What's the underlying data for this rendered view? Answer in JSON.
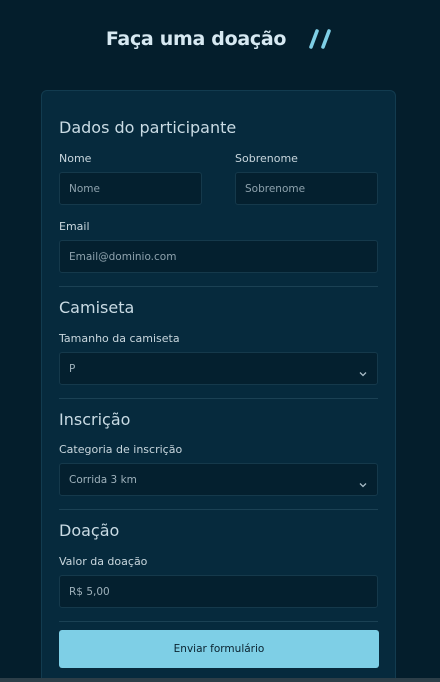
{
  "header": {
    "title": "Faça uma doação",
    "logo_icon": "double-slash-logo-icon",
    "accent_color": "#7ecfe6"
  },
  "form": {
    "participant": {
      "section_title": "Dados do participante",
      "first_name_label": "Nome",
      "first_name_placeholder": "Nome",
      "last_name_label": "Sobrenome",
      "last_name_placeholder": "Sobrenome",
      "email_label": "Email",
      "email_placeholder": "Email@dominio.com"
    },
    "shirt": {
      "section_title": "Camiseta",
      "size_label": "Tamanho da camiseta",
      "size_value": "P"
    },
    "registration": {
      "section_title": "Inscrição",
      "category_label": "Categoria de inscrição",
      "category_value": "Corrida 3 km"
    },
    "donation": {
      "section_title": "Doação",
      "amount_label": "Valor da doação",
      "amount_value": "R$ 5,00"
    },
    "submit_label": "Enviar formulário"
  }
}
